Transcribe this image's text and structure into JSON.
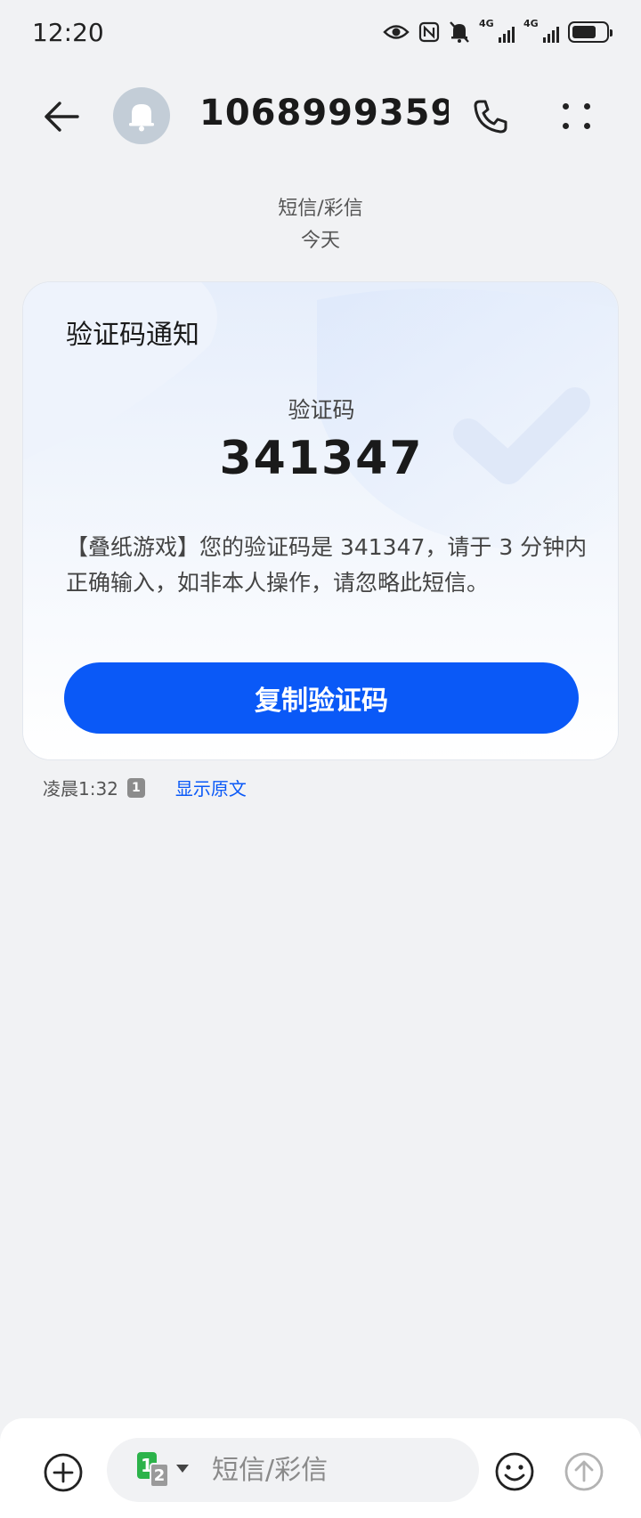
{
  "status_bar": {
    "time": "12:20",
    "signal1_label": "4G",
    "signal2_label": "4G",
    "icons": [
      "eye-icon",
      "nfc-icon",
      "mute-bell-icon",
      "signal-icon",
      "signal-icon",
      "battery-icon"
    ]
  },
  "header": {
    "contact": "1068999359…",
    "back_icon": "arrow-left-icon",
    "avatar_icon": "bell-icon",
    "call_icon": "phone-icon",
    "more_icon": "more-dots-icon"
  },
  "divider": {
    "type": "短信/彩信",
    "day": "今天"
  },
  "card": {
    "title": "验证码通知",
    "code_label": "验证码",
    "code": "341347",
    "body": "【叠纸游戏】您的验证码是 341347，请于 3 分钟内正确输入，如非本人操作，请忽略此短信。",
    "copy_button": "复制验证码"
  },
  "meta": {
    "time": "凌晨1:32",
    "sim": "1",
    "show_original": "显示原文"
  },
  "input_bar": {
    "sim1": "1",
    "sim2": "2",
    "placeholder": "短信/彩信"
  },
  "colors": {
    "accent": "#0a59f7",
    "background": "#f1f2f4",
    "sim_green": "#2cb34a"
  }
}
